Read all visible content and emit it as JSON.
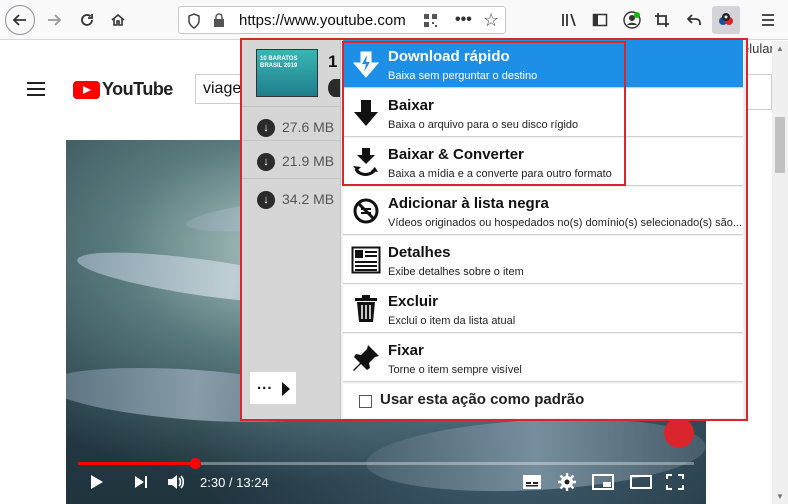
{
  "browser": {
    "url": "https://www.youtube.com",
    "icons": [
      "back-icon",
      "forward-icon",
      "reload-icon",
      "home-icon",
      "shield-icon",
      "lock-icon",
      "qr-icon",
      "more-icon",
      "star-icon",
      "library-icon",
      "sidebar-icon",
      "account-icon",
      "crop-icon",
      "undo-icon",
      "extension-icon",
      "menu-icon"
    ]
  },
  "youtube": {
    "logo": "YouTube",
    "search_value": "viage",
    "side_text": "elular",
    "time": "2:30 / 13:24",
    "progress": 0.19,
    "accent": "#ff0000"
  },
  "popup": {
    "first_item_prefix": "1",
    "thumb_text": "10 BARATOS BRASIL 2019",
    "downloads": [
      {
        "size": "27.6 MB"
      },
      {
        "size": "21.9 MB"
      },
      {
        "size": "34.2 MB"
      }
    ],
    "more_label": "...",
    "menu": [
      {
        "title": "Download rápido",
        "desc": "Baixa sem perguntar o destino",
        "icon": "lightning-download-icon",
        "active": true
      },
      {
        "title": "Baixar",
        "desc": "Baixa o arquivo para o seu disco rígido",
        "icon": "down-arrow-icon",
        "active": false
      },
      {
        "title": "Baixar & Converter",
        "desc": "Baixa a mídia e a converte para outro formato",
        "icon": "convert-icon",
        "active": false
      },
      {
        "title": "Adicionar à lista negra",
        "desc": "Vídeos originados ou hospedados no(s) domínio(s) selecionado(s) são...",
        "icon": "blacklist-icon",
        "active": false
      },
      {
        "title": "Detalhes",
        "desc": "Exibe detalhes sobre o item",
        "icon": "details-icon",
        "active": false
      },
      {
        "title": "Excluir",
        "desc": "Exclui o item da lista atual",
        "icon": "trash-icon",
        "active": false
      },
      {
        "title": "Fixar",
        "desc": "Torne o item sempre visível",
        "icon": "pin-icon",
        "active": false
      }
    ],
    "default_label": "Usar esta ação como padrão",
    "default_checked": false,
    "active_color": "#1e8fe6",
    "highlight_color": "#d9252b"
  }
}
